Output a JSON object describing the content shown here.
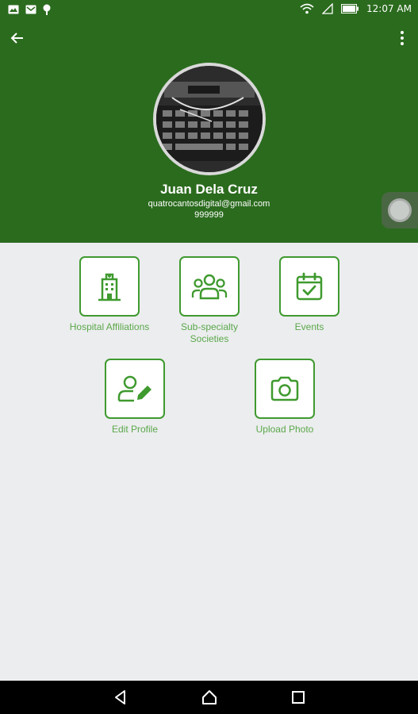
{
  "status_bar": {
    "time": "12:07 AM",
    "left_icons": [
      "gallery-icon",
      "mail-icon",
      "location-icon"
    ],
    "right_icons": [
      "wifi-icon",
      "signal-icon",
      "battery-icon"
    ]
  },
  "header": {
    "bg_color": "#2b6b1e",
    "back_icon": "arrow-back-icon",
    "menu_icon": "more-vert-icon"
  },
  "profile": {
    "name": "Juan Dela Cruz",
    "email": "quatrocantosdigital@gmail.com",
    "phone": "999999"
  },
  "tiles": [
    {
      "label": "Hospital Affiliations",
      "icon": "hospital-building-icon"
    },
    {
      "label": "Sub-specialty Societies",
      "icon": "users-group-icon"
    },
    {
      "label": "Events",
      "icon": "calendar-check-icon"
    },
    {
      "label": "Edit Profile",
      "icon": "user-edit-icon"
    },
    {
      "label": "Upload Photo",
      "icon": "camera-icon"
    }
  ],
  "accent_color": "#3f9a2f",
  "nav_bar": {
    "buttons": [
      "back-nav-icon",
      "home-nav-icon",
      "recents-nav-icon"
    ]
  }
}
